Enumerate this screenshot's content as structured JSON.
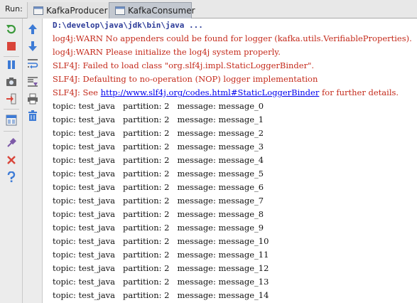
{
  "run_bar": {
    "label": "Run:",
    "tabs": [
      {
        "label": "KafkaProducer",
        "active": false
      },
      {
        "label": "KafkaConsumer",
        "active": true
      }
    ]
  },
  "left_toolbar": {
    "tools": [
      {
        "name": "rerun-icon",
        "color": "#3c9a3c"
      },
      {
        "name": "stop-icon",
        "color": "#d9453a"
      },
      {
        "name": "pause-icon",
        "color": "#3d7bd6"
      },
      {
        "name": "dump-threads-icon",
        "color": "#555555"
      },
      {
        "name": "exit-icon",
        "color": "#d9453a"
      },
      {
        "name": "restore-layout-icon",
        "color": "#3d7bd6"
      },
      {
        "name": "pin-icon",
        "color": "#7d5aa8"
      },
      {
        "name": "close-icon",
        "color": "#d9453a"
      },
      {
        "name": "help-icon",
        "color": "#3d7bd6"
      }
    ]
  },
  "right_toolbar": {
    "tools": [
      {
        "name": "up-arrow-icon",
        "color": "#3d7bd6"
      },
      {
        "name": "down-arrow-icon",
        "color": "#3d7bd6"
      },
      {
        "name": "soft-wrap-icon",
        "color": "#3d7bd6"
      },
      {
        "name": "scroll-to-end-icon",
        "color": "#3d7bd6"
      },
      {
        "name": "print-icon",
        "color": "#555555"
      },
      {
        "name": "clear-all-icon",
        "color": "#3d7bd6"
      }
    ]
  },
  "console": {
    "command": "D:\\develop\\java\\jdk\\bin\\java ...",
    "warnings": [
      "log4j:WARN No appenders could be found for logger (kafka.utils.VerifiableProperties).",
      "log4j:WARN Please initialize the log4j system properly.",
      "SLF4J: Failed to load class \"org.slf4j.impl.StaticLoggerBinder\".",
      "SLF4J: Defaulting to no-operation (NOP) logger implementation"
    ],
    "slf4j_see": {
      "prefix": "SLF4J: See ",
      "link": "http://www.slf4j.org/codes.html#StaticLoggerBinder",
      "suffix": " for further details."
    },
    "messages": [
      "topic: test_java   partition: 2   message: message_0",
      "topic: test_java   partition: 2   message: message_1",
      "topic: test_java   partition: 2   message: message_2",
      "topic: test_java   partition: 2   message: message_3",
      "topic: test_java   partition: 2   message: message_4",
      "topic: test_java   partition: 2   message: message_5",
      "topic: test_java   partition: 2   message: message_6",
      "topic: test_java   partition: 2   message: message_7",
      "topic: test_java   partition: 2   message: message_8",
      "topic: test_java   partition: 2   message: message_9",
      "topic: test_java   partition: 2   message: message_10",
      "topic: test_java   partition: 2   message: message_11",
      "topic: test_java   partition: 2   message: message_12",
      "topic: test_java   partition: 2   message: message_13",
      "topic: test_java   partition: 2   message: message_14"
    ]
  }
}
